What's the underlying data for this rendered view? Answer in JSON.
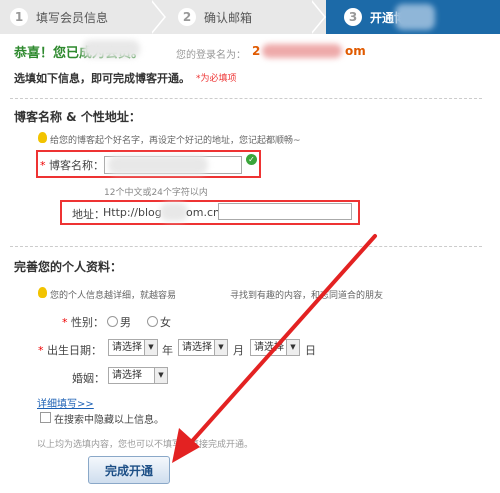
{
  "steps": [
    {
      "num": "1",
      "label": "填写会员信息"
    },
    {
      "num": "2",
      "label": "确认邮箱"
    },
    {
      "num": "3",
      "label": "开通博客"
    }
  ],
  "header": {
    "congrats": "恭喜！您已成为会员。",
    "login_label": "您的登录名为：",
    "login_value": "2",
    "login_suffix": "om",
    "instruction": "选填如下信息，即可完成博客开通。",
    "required_note": "*为必填项"
  },
  "blog_section": {
    "title": "博客名称 & 个性地址：",
    "tip": "给您的博客起个好名字，再设定个好记的地址，您记起都顺畅~",
    "name_label": "博客名称：",
    "name_hint": "12个中文或24个字符以内",
    "address_label": "地址：",
    "address_prefix": "Http://blog",
    "address_suffix": "om.cn/"
  },
  "profile_section": {
    "title": "完善您的个人资料：",
    "tip_left": "您的个人信息越详细，就越容易",
    "tip_right": "寻找到有趣的内容，和志同道合的朋友",
    "gender_label": "性别：",
    "gender_options": [
      "男",
      "女"
    ],
    "birthday_label": "出生日期：",
    "select_placeholder": "请选择",
    "year": "年",
    "month": "月",
    "day": "日",
    "marital_label": "婚姻：",
    "detail_link": "详细填写>>",
    "hide_checkbox": "在搜索中隐藏以上信息。",
    "footer_note": "以上均为选填内容，您也可以不填写，直接完成开通。"
  },
  "submit_label": "完成开通",
  "colors": {
    "accent": "#1c6aa8",
    "green": "#2f8a2f",
    "red_box": "#e33333",
    "arrow": "#e32222"
  }
}
